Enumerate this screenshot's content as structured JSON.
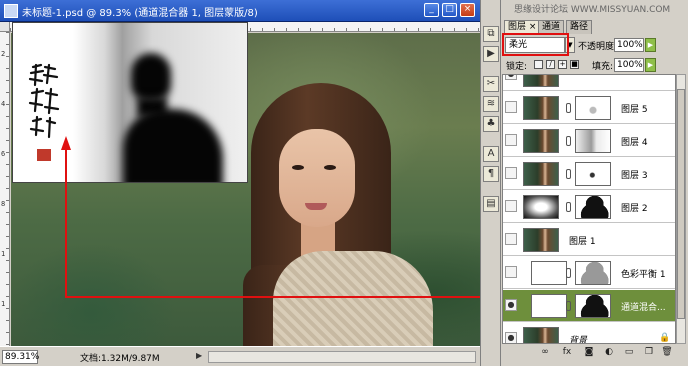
{
  "window": {
    "title": "未标题-1.psd @ 89.3% (通道混合器 1, 图层蒙版/8)",
    "controls": [
      "_",
      "□",
      "×"
    ]
  },
  "rulers": {
    "left_marks": [
      "2",
      "4",
      "6",
      "8",
      "1",
      "1"
    ]
  },
  "statusbar": {
    "zoom": "89.31%",
    "doc_info": "文档:1.32M/9.87M"
  },
  "watermark": "思缘设计论坛 WWW.MISSYUAN.COM",
  "panel": {
    "tabs": [
      "图层 ×",
      "通道",
      "路径"
    ],
    "blend_mode": "柔光",
    "opacity_label": "不透明度:",
    "opacity_value": "100%",
    "lock_label": "锁定:",
    "fill_label": "填充:",
    "fill_value": "100%",
    "layers": [
      {
        "name": "",
        "visible": true,
        "thumb": "photo",
        "mask": "",
        "selected": false
      },
      {
        "name": "图层 5",
        "visible": false,
        "thumb": "photo",
        "mask": "mask-white",
        "selected": false
      },
      {
        "name": "图层 4",
        "visible": false,
        "thumb": "photo",
        "mask": "mask-grey",
        "selected": false
      },
      {
        "name": "图层 3",
        "visible": false,
        "thumb": "photo",
        "mask": "mask-dot",
        "selected": false
      },
      {
        "name": "图层 2",
        "visible": false,
        "thumb": "mask-rad",
        "mask": "mask-sil",
        "selected": false
      },
      {
        "name": "图层 1",
        "visible": false,
        "thumb": "photo",
        "mask": "",
        "selected": false
      },
      {
        "name": "色彩平衡 1",
        "visible": false,
        "thumb": "adj",
        "mask": "mask-sil-grey",
        "selected": false
      },
      {
        "name": "通道混合...",
        "visible": true,
        "thumb": "adj",
        "mask": "mask-sil",
        "selected": true
      },
      {
        "name": "背景",
        "visible": true,
        "thumb": "photo",
        "mask": "",
        "selected": false,
        "locked": true
      }
    ],
    "toolbar_icons": [
      "link-icon",
      "fx-icon",
      "mask-icon",
      "adjustment-icon",
      "folder-icon",
      "new-layer-icon",
      "trash-icon"
    ]
  },
  "toolstrip_icons": [
    "history-icon",
    "actions-icon",
    "tool-presets-icon",
    "brushes-icon",
    "clone-icon",
    "character-icon",
    "paragraph-icon",
    "layer-comps-icon"
  ],
  "colors": {
    "selection_red": "#e01010",
    "selected_row": "#6e8f3c",
    "titlebar": "#2458c7"
  }
}
